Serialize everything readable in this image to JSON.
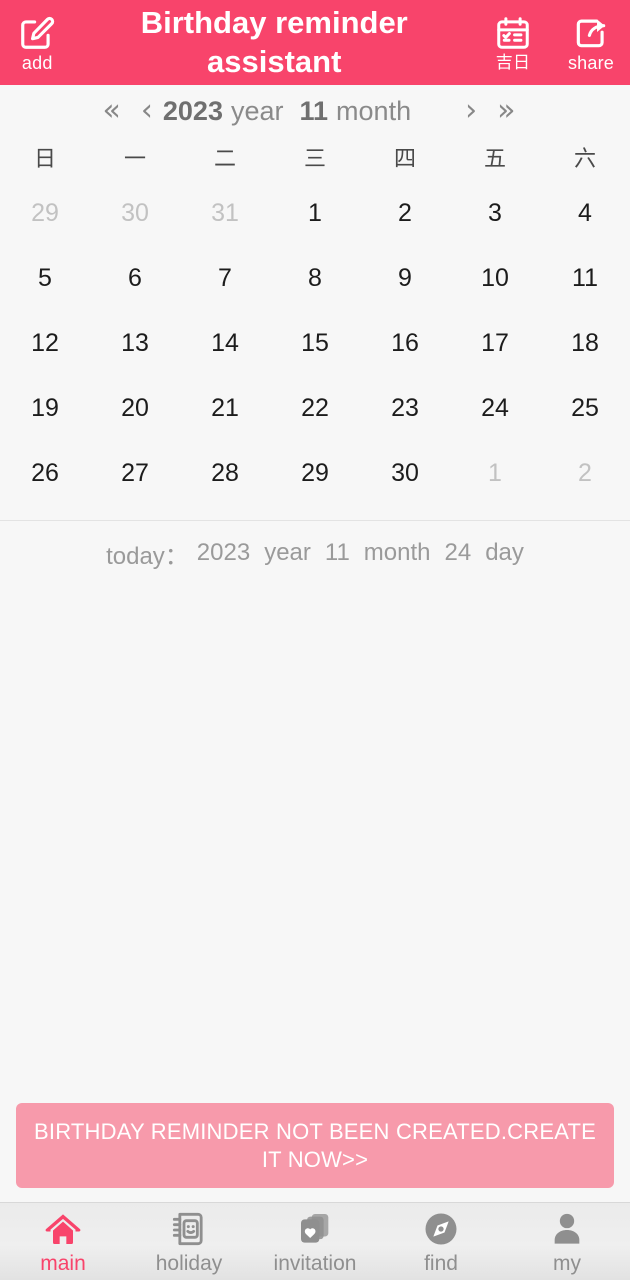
{
  "header": {
    "title": "Birthday reminder assistant",
    "add_label": "add",
    "add_icon": "edit-square-icon",
    "luckyday_label": "吉日",
    "luckyday_icon": "calendar-check-icon",
    "share_label": "share",
    "share_icon": "share-arrow-icon",
    "bg_color": "#f8446b"
  },
  "monthnav": {
    "prev_year_icon": "double-chevron-left-icon",
    "prev_month_icon": "chevron-left-icon",
    "next_month_icon": "chevron-right-icon",
    "next_year_icon": "double-chevron-right-icon",
    "prev_year": "«",
    "prev_month": "‹",
    "next_month": "›",
    "next_year": "»",
    "year": "2023",
    "year_unit": "year",
    "month": "11",
    "month_unit": "month"
  },
  "weekdays": [
    "日",
    "一",
    "二",
    "三",
    "四",
    "五",
    "六"
  ],
  "calendar": {
    "cells": [
      {
        "d": "29",
        "muted": true
      },
      {
        "d": "30",
        "muted": true
      },
      {
        "d": "31",
        "muted": true
      },
      {
        "d": "1",
        "muted": false
      },
      {
        "d": "2",
        "muted": false
      },
      {
        "d": "3",
        "muted": false
      },
      {
        "d": "4",
        "muted": false
      },
      {
        "d": "5",
        "muted": false
      },
      {
        "d": "6",
        "muted": false
      },
      {
        "d": "7",
        "muted": false
      },
      {
        "d": "8",
        "muted": false
      },
      {
        "d": "9",
        "muted": false
      },
      {
        "d": "10",
        "muted": false
      },
      {
        "d": "11",
        "muted": false
      },
      {
        "d": "12",
        "muted": false
      },
      {
        "d": "13",
        "muted": false
      },
      {
        "d": "14",
        "muted": false
      },
      {
        "d": "15",
        "muted": false
      },
      {
        "d": "16",
        "muted": false
      },
      {
        "d": "17",
        "muted": false
      },
      {
        "d": "18",
        "muted": false
      },
      {
        "d": "19",
        "muted": false
      },
      {
        "d": "20",
        "muted": false
      },
      {
        "d": "21",
        "muted": false
      },
      {
        "d": "22",
        "muted": false
      },
      {
        "d": "23",
        "muted": false
      },
      {
        "d": "24",
        "muted": false
      },
      {
        "d": "25",
        "muted": false
      },
      {
        "d": "26",
        "muted": false
      },
      {
        "d": "27",
        "muted": false
      },
      {
        "d": "28",
        "muted": false
      },
      {
        "d": "29",
        "muted": false
      },
      {
        "d": "30",
        "muted": false
      },
      {
        "d": "1",
        "muted": true
      },
      {
        "d": "2",
        "muted": true
      }
    ]
  },
  "today": {
    "prefix": "today：",
    "year": "2023",
    "year_unit": "year",
    "month": "11",
    "month_unit": "month",
    "day": "24",
    "day_unit": "day"
  },
  "notice": {
    "text": "BIRTHDAY REMINDER NOT BEEN CREATED.CREATE IT NOW>>",
    "bg_color": "#f79aab"
  },
  "tabs": [
    {
      "label": "main",
      "icon": "home-icon",
      "active": true
    },
    {
      "label": "holiday",
      "icon": "notebook-face-icon",
      "active": false
    },
    {
      "label": "invitation",
      "icon": "cards-heart-icon",
      "active": false
    },
    {
      "label": "find",
      "icon": "compass-icon",
      "active": false
    },
    {
      "label": "my",
      "icon": "person-icon",
      "active": false
    }
  ],
  "colors": {
    "accent": "#f8446b",
    "page_bg": "#f7f7f7",
    "muted_day": "#c2c2c2"
  }
}
